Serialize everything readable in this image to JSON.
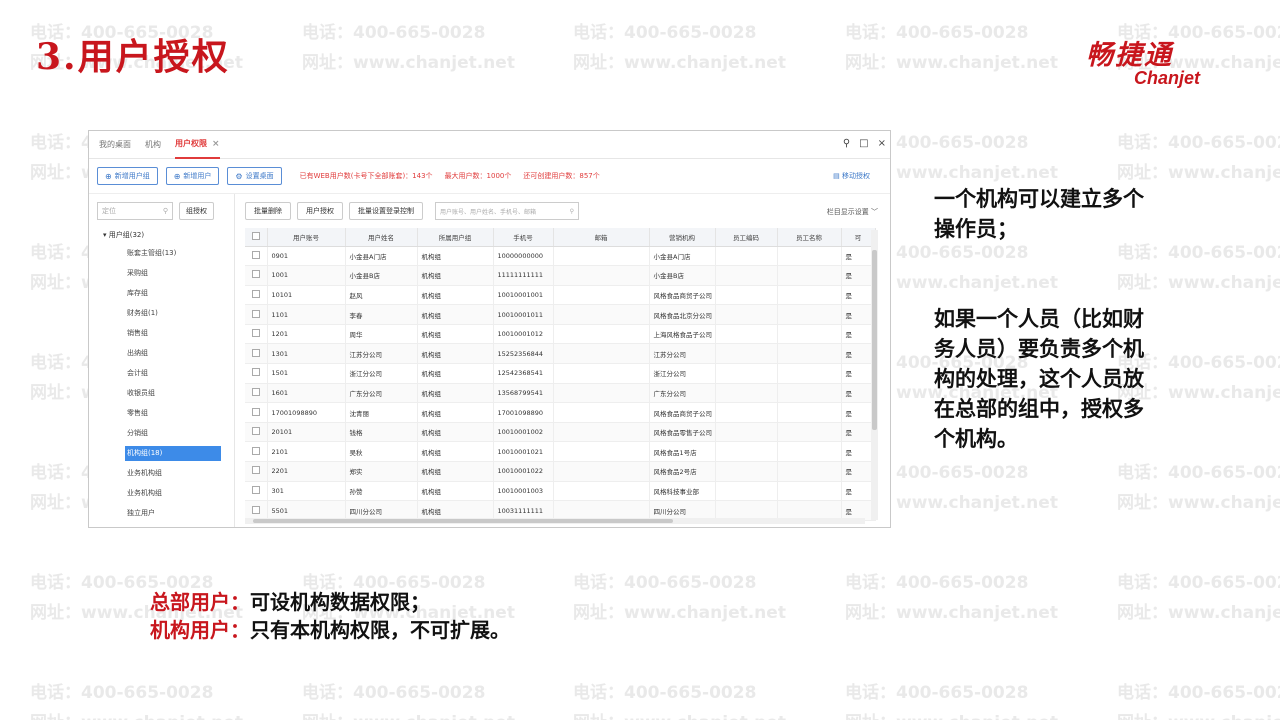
{
  "slide": {
    "title": "3.用户授权",
    "logo_cn": "畅捷通",
    "logo_en": "Chanjet",
    "watermark_phone": "电话：400-665-0028",
    "watermark_site": "网址：www.chanjet.net",
    "accent_color": "#c8161d"
  },
  "window": {
    "tabs": [
      {
        "label": "我的桌面"
      },
      {
        "label": "机构"
      },
      {
        "label": "用户权限",
        "active": true
      }
    ],
    "tab_close": "×",
    "controls": {
      "search": "⚲",
      "maximize": "□",
      "close": "×"
    }
  },
  "toolbar": {
    "new_group": "新增用户组",
    "new_user": "新增用户",
    "set_desktop": "设置桌面",
    "notice_1": "已有WEB用户数(卡号下全部账套)：143个",
    "notice_2": "最大用户数：1000个",
    "notice_3": "还可创建用户数：857个",
    "move_auth": "移动授权"
  },
  "left_panel": {
    "search_placeholder": "定位",
    "group_auth_btn": "组授权",
    "root": "用户组(32)",
    "groups": [
      "账套主管组(13)",
      "采购组",
      "库存组",
      "财务组(1)",
      "销售组",
      "出纳组",
      "会计组",
      "收银员组",
      "零售组",
      "分销组",
      "机构组(18)",
      "业务机构组",
      "业务机构组",
      "独立用户"
    ],
    "active_index": 10
  },
  "right_panel": {
    "batch_delete": "批量删除",
    "user_auth": "用户授权",
    "batch_login": "批量设置登录控制",
    "search_placeholder": "用户账号、用户姓名、手机号、邮箱",
    "col_setting": "栏目显示设置 ﹀"
  },
  "table": {
    "columns": [
      "用户账号",
      "用户姓名",
      "所属用户组",
      "手机号",
      "邮箱",
      "营销机构",
      "员工编码",
      "员工名称",
      "可"
    ],
    "rows": [
      [
        "0901",
        "小金县A门店",
        "机构组",
        "10000000000",
        "",
        "小金县A门店",
        "",
        "",
        "是"
      ],
      [
        "1001",
        "小金县B店",
        "机构组",
        "11111111111",
        "",
        "小金县B店",
        "",
        "",
        "是"
      ],
      [
        "10101",
        "赵风",
        "机构组",
        "10010001001",
        "",
        "风格食品商贸子公司",
        "",
        "",
        "是"
      ],
      [
        "1101",
        "李春",
        "机构组",
        "10010001011",
        "",
        "风格食品北京分公司",
        "",
        "",
        "是"
      ],
      [
        "1201",
        "周华",
        "机构组",
        "10010001012",
        "",
        "上海风格食品子公司",
        "",
        "",
        "是"
      ],
      [
        "1301",
        "江苏分公司",
        "机构组",
        "15252356844",
        "",
        "江苏分公司",
        "",
        "",
        "是"
      ],
      [
        "1501",
        "浙江分公司",
        "机构组",
        "12542368541",
        "",
        "浙江分公司",
        "",
        "",
        "是"
      ],
      [
        "1601",
        "广东分公司",
        "机构组",
        "13568799541",
        "",
        "广东分公司",
        "",
        "",
        "是"
      ],
      [
        "17001098890",
        "沈青丽",
        "机构组",
        "17001098890",
        "",
        "风格食品商贸子公司",
        "",
        "",
        "是"
      ],
      [
        "20101",
        "钱格",
        "机构组",
        "10010001002",
        "",
        "风格食品零售子公司",
        "",
        "",
        "是"
      ],
      [
        "2101",
        "吴秋",
        "机构组",
        "10010001021",
        "",
        "风格食品1号店",
        "",
        "",
        "是"
      ],
      [
        "2201",
        "郑实",
        "机构组",
        "10010001022",
        "",
        "风格食品2号店",
        "",
        "",
        "是"
      ],
      [
        "301",
        "孙赞",
        "机构组",
        "10010001003",
        "",
        "风格科技事业部",
        "",
        "",
        "是"
      ],
      [
        "5501",
        "四川分公司",
        "机构组",
        "10031111111",
        "",
        "四川分公司",
        "",
        "",
        "是"
      ]
    ]
  },
  "side_text": {
    "p1": "一个机构可以建立多个操作员；",
    "p2": "如果一个人员（比如财务人员）要负责多个机构的处理，这个人员放在总部的组中，授权多个机构。"
  },
  "bottom_text": {
    "hq_label": "总部用户：",
    "hq_text": "可设机构数据权限；",
    "org_label": "机构用户：",
    "org_text": "只有本机构权限，不可扩展。"
  }
}
